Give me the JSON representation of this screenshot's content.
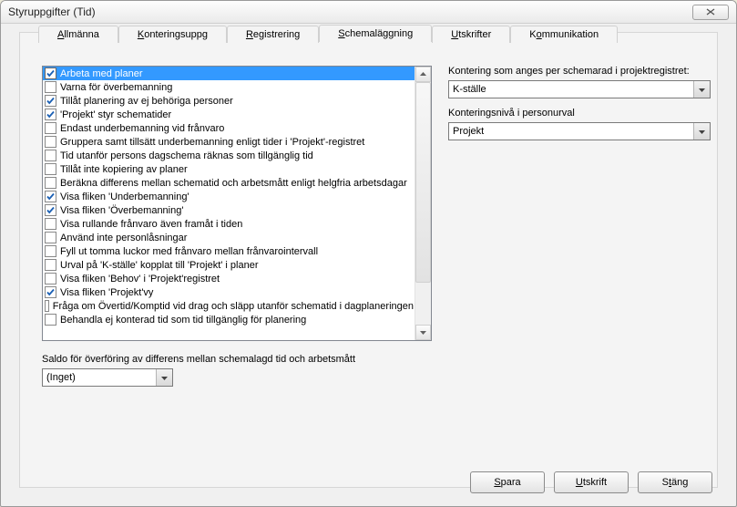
{
  "window": {
    "title": "Styruppgifter (Tid)"
  },
  "tabs": [
    {
      "pre": "",
      "u": "A",
      "post": "llmänna",
      "active": false
    },
    {
      "pre": "",
      "u": "K",
      "post": "onteringsuppg",
      "active": false
    },
    {
      "pre": "",
      "u": "R",
      "post": "egistrering",
      "active": false
    },
    {
      "pre": "",
      "u": "S",
      "post": "chemaläggning",
      "active": true
    },
    {
      "pre": "",
      "u": "U",
      "post": "tskrifter",
      "active": false
    },
    {
      "pre": "K",
      "u": "o",
      "post": "mmunikation",
      "active": false
    }
  ],
  "list_items": [
    {
      "checked": true,
      "selected": true,
      "label": "Arbeta med planer"
    },
    {
      "checked": false,
      "selected": false,
      "label": "Varna för överbemanning"
    },
    {
      "checked": true,
      "selected": false,
      "label": "Tillåt planering av ej behöriga personer"
    },
    {
      "checked": true,
      "selected": false,
      "label": "'Projekt' styr schematider"
    },
    {
      "checked": false,
      "selected": false,
      "label": "Endast underbemanning vid frånvaro"
    },
    {
      "checked": false,
      "selected": false,
      "label": "Gruppera samt tillsätt underbemanning enligt tider i 'Projekt'-registret"
    },
    {
      "checked": false,
      "selected": false,
      "label": "Tid utanför persons dagschema räknas som tillgänglig tid"
    },
    {
      "checked": false,
      "selected": false,
      "label": "Tillåt inte kopiering av planer"
    },
    {
      "checked": false,
      "selected": false,
      "label": "Beräkna differens mellan schematid och arbetsmått enligt helgfria arbetsdagar"
    },
    {
      "checked": true,
      "selected": false,
      "label": "Visa fliken 'Underbemanning'"
    },
    {
      "checked": true,
      "selected": false,
      "label": "Visa fliken 'Överbemanning'"
    },
    {
      "checked": false,
      "selected": false,
      "label": "Visa rullande frånvaro även framåt i tiden"
    },
    {
      "checked": false,
      "selected": false,
      "label": "Använd inte personlåsningar"
    },
    {
      "checked": false,
      "selected": false,
      "label": "Fyll ut tomma luckor med frånvaro mellan frånvarointervall"
    },
    {
      "checked": false,
      "selected": false,
      "label": "Urval på 'K-ställe' kopplat till 'Projekt' i planer"
    },
    {
      "checked": false,
      "selected": false,
      "label": "Visa fliken 'Behov' i 'Projekt'registret"
    },
    {
      "checked": true,
      "selected": false,
      "label": "Visa fliken 'Projekt'vy"
    },
    {
      "checked": false,
      "selected": false,
      "label": "Fråga om Övertid/Komptid vid drag och släpp utanför schematid i dagplaneringen"
    },
    {
      "checked": false,
      "selected": false,
      "label": "Behandla ej konterad tid som tid tillgänglig för planering"
    }
  ],
  "right": {
    "label1": "Kontering som anges per schemarad i projektregistret:",
    "combo1": "K-ställe",
    "label2": "Konteringsnivå i personurval",
    "combo2": "Projekt"
  },
  "saldo": {
    "label": "Saldo för överföring av differens mellan schemalagd tid och arbetsmått",
    "value": "(Inget)"
  },
  "buttons": {
    "save": {
      "pre": "",
      "u": "S",
      "post": "para"
    },
    "print": {
      "pre": "",
      "u": "U",
      "post": "tskrift"
    },
    "close": {
      "pre": "S",
      "u": "t",
      "post": "äng"
    }
  }
}
